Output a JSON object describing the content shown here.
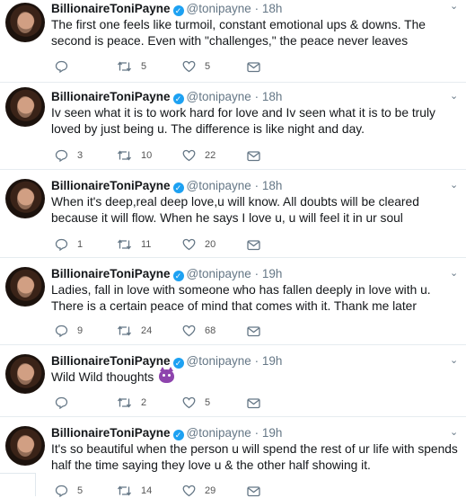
{
  "tweets": [
    {
      "name": "BillionaireToniPayne",
      "handle": "@tonipayne",
      "sep": "·",
      "time": "18h",
      "text": "The first one feels like turmoil, constant emotional ups & downs. The second is peace. Even with \"challenges,\" the peace never leaves",
      "replies": "",
      "retweets": "5",
      "likes": "5"
    },
    {
      "name": "BillionaireToniPayne",
      "handle": "@tonipayne",
      "sep": "·",
      "time": "18h",
      "text": "Iv seen what it is to work hard for love and Iv seen what it is to be truly loved by just being u. The difference is like night and day.",
      "replies": "3",
      "retweets": "10",
      "likes": "22"
    },
    {
      "name": "BillionaireToniPayne",
      "handle": "@tonipayne",
      "sep": "·",
      "time": "18h",
      "text": "When it's deep,real deep love,u will know. All doubts will be cleared because it will flow. When he says I love u, u will feel it in ur soul",
      "replies": "1",
      "retweets": "11",
      "likes": "20"
    },
    {
      "name": "BillionaireToniPayne",
      "handle": "@tonipayne",
      "sep": "·",
      "time": "19h",
      "text": "Ladies, fall in love with someone who has fallen deeply in love with u. There is a certain peace of mind that comes with it. Thank me later",
      "replies": "9",
      "retweets": "24",
      "likes": "68"
    },
    {
      "name": "BillionaireToniPayne",
      "handle": "@tonipayne",
      "sep": "·",
      "time": "19h",
      "text": "Wild Wild thoughts",
      "replies": "",
      "retweets": "2",
      "likes": "5"
    },
    {
      "name": "BillionaireToniPayne",
      "handle": "@tonipayne",
      "sep": "·",
      "time": "19h",
      "text": "It's so beautiful when the person u will spend the rest of ur life with spends half the time saying they love u & the other half showing it.",
      "replies": "5",
      "retweets": "14",
      "likes": "29"
    }
  ],
  "icons": {
    "reply": "reply-icon",
    "retweet": "retweet-icon",
    "like": "heart-icon",
    "dm": "envelope-icon",
    "verified": "verified-badge-icon",
    "emoji": "smiling-devil-emoji"
  },
  "colors": {
    "verified": "#1da1f2",
    "muted": "#657786",
    "divider": "#e6ecf0"
  }
}
